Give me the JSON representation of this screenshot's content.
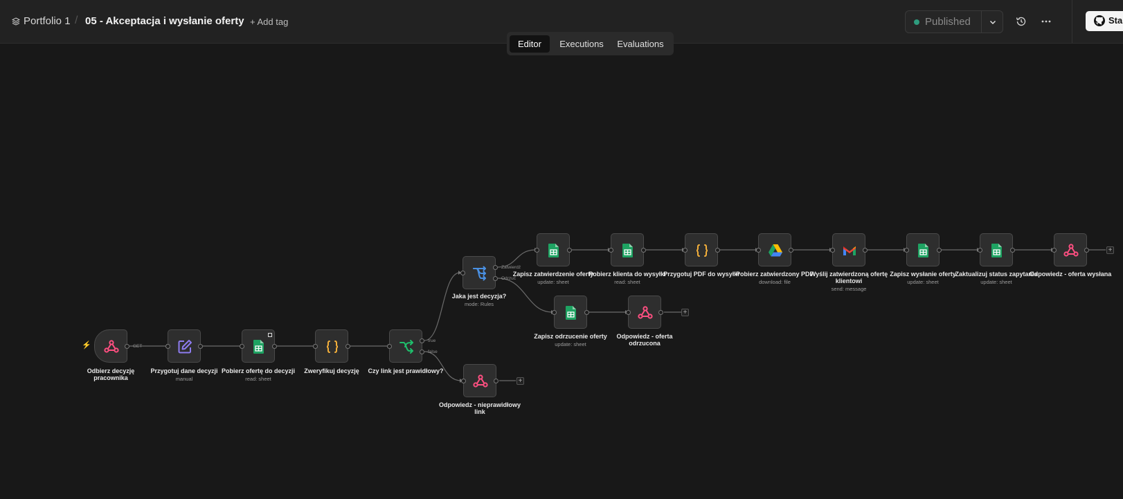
{
  "header": {
    "project": "Portfolio 1",
    "separator": "/",
    "workflow_title": "05 - Akceptacja i wysłanie oferty",
    "add_tag": "+ Add tag",
    "published": "Published",
    "star": "Star"
  },
  "tabs": [
    {
      "label": "Editor"
    },
    {
      "label": "Executions"
    },
    {
      "label": "Evaluations"
    }
  ],
  "nodes": [
    {
      "label": "Odbierz decyzję pracownika",
      "sub": "",
      "icon": "webhook-icon"
    },
    {
      "label": "Przygotuj dane decyzji",
      "sub": "manual",
      "icon": "edit-icon"
    },
    {
      "label": "Pobierz ofertę do decyzji",
      "sub": "read: sheet",
      "icon": "google-sheets-icon"
    },
    {
      "label": "Zweryfikuj decyzję",
      "sub": "",
      "icon": "code-braces-icon"
    },
    {
      "label": "Czy link jest prawidłowy?",
      "sub": "",
      "icon": "if-branch-icon"
    },
    {
      "label": "Jaka jest decyzja?",
      "sub": "mode: Rules",
      "icon": "switch-icon"
    },
    {
      "label": "Odpowiedz - nieprawidłowy link",
      "sub": "",
      "icon": "webhook-icon"
    },
    {
      "label": "Zapisz zatwierdzenie oferty",
      "sub": "update: sheet",
      "icon": "google-sheets-icon"
    },
    {
      "label": "Zapisz odrzucenie oferty",
      "sub": "update: sheet",
      "icon": "google-sheets-icon"
    },
    {
      "label": "Pobierz klienta do wysyłki",
      "sub": "read: sheet",
      "icon": "google-sheets-icon"
    },
    {
      "label": "Odpowiedz - oferta odrzucona",
      "sub": "",
      "icon": "webhook-icon"
    },
    {
      "label": "Przygotuj PDF do wysyłki",
      "sub": "",
      "icon": "code-braces-icon"
    },
    {
      "label": "Pobierz zatwierdzony PDF",
      "sub": "download: file",
      "icon": "google-drive-icon"
    },
    {
      "label": "Wyślij zatwierdzoną ofertę klientowi",
      "sub": "send: message",
      "icon": "gmail-icon"
    },
    {
      "label": "Zapisz wysłanie oferty",
      "sub": "update: sheet",
      "icon": "google-sheets-icon"
    },
    {
      "label": "Zaktualizuj status zapytania",
      "sub": "update: sheet",
      "icon": "google-sheets-icon"
    },
    {
      "label": "Odpowiedz - oferta wysłana",
      "sub": "",
      "icon": "webhook-icon"
    }
  ],
  "branch_labels": {
    "get": "GET",
    "true": "true",
    "false": "false",
    "approve": "Zatwierdź",
    "reject": "Odrzuć"
  },
  "colors": {
    "webhook": "#ff4f81",
    "sheets": "#1ea362",
    "edit": "#8e7cf0",
    "code": "#f6b13b",
    "if": "#1fbf6c",
    "switch": "#4a90e2",
    "published_dot": "#2e9c7e"
  }
}
